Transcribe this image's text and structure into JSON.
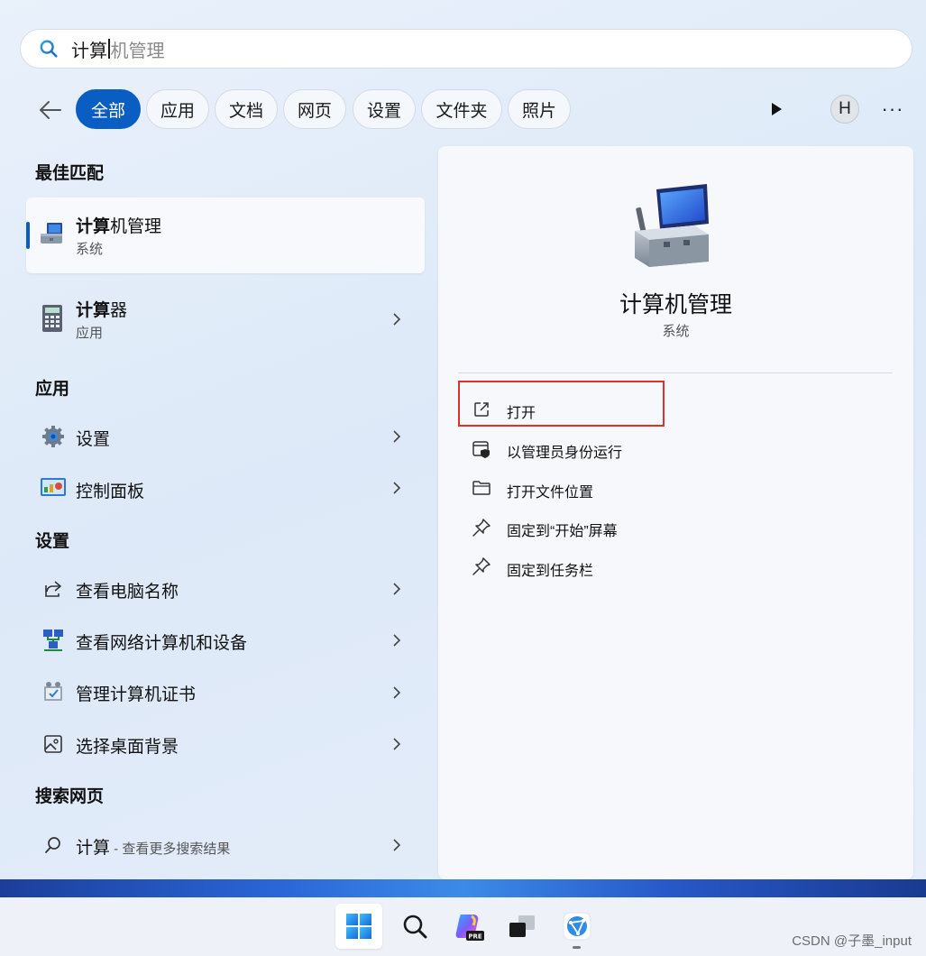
{
  "search": {
    "typed": "计算",
    "suggestion": "机管理"
  },
  "filters": [
    {
      "label": "全部",
      "active": true
    },
    {
      "label": "应用",
      "active": false
    },
    {
      "label": "文档",
      "active": false
    },
    {
      "label": "网页",
      "active": false
    },
    {
      "label": "设置",
      "active": false
    },
    {
      "label": "文件夹",
      "active": false
    },
    {
      "label": "照片",
      "active": false
    }
  ],
  "avatar_letter": "H",
  "more_label": "···",
  "sections": {
    "best_match": "最佳匹配",
    "apps": "应用",
    "settings": "设置",
    "web": "搜索网页"
  },
  "best_match": {
    "title_bold": "计算",
    "title_rest": "机管理",
    "subtitle": "系统",
    "icon": "computer-management-icon"
  },
  "results_top": [
    {
      "title_bold": "计算",
      "title_rest": "器",
      "subtitle": "应用",
      "icon": "calculator-icon"
    }
  ],
  "apps": [
    {
      "label": "设置",
      "icon": "settings-gear-icon"
    },
    {
      "label": "控制面板",
      "icon": "control-panel-icon"
    }
  ],
  "settings_items": [
    {
      "label": "查看电脑名称",
      "icon": "share-icon"
    },
    {
      "label": "查看网络计算机和设备",
      "icon": "network-computers-icon"
    },
    {
      "label": "管理计算机证书",
      "icon": "certificate-icon"
    },
    {
      "label": "选择桌面背景",
      "icon": "image-icon"
    }
  ],
  "web_search": {
    "query": "计算",
    "suffix": " - 查看更多搜索结果",
    "icon": "search-icon"
  },
  "preview": {
    "title": "计算机管理",
    "subtitle": "系统",
    "actions": [
      {
        "label": "打开",
        "icon": "open-external-icon"
      },
      {
        "label": "以管理员身份运行",
        "icon": "admin-shield-icon"
      },
      {
        "label": "打开文件位置",
        "icon": "folder-icon"
      },
      {
        "label": "固定到“开始”屏幕",
        "icon": "pin-icon"
      },
      {
        "label": "固定到任务栏",
        "icon": "pin-icon"
      }
    ]
  },
  "taskbar": [
    "windows-start-icon",
    "search-icon",
    "copilot-pre-icon",
    "task-view-icon",
    "browser-app-icon"
  ],
  "watermark": "CSDN @子墨_input",
  "colors": {
    "accent": "#0a5dc2",
    "highlight_border": "#e0302a"
  }
}
